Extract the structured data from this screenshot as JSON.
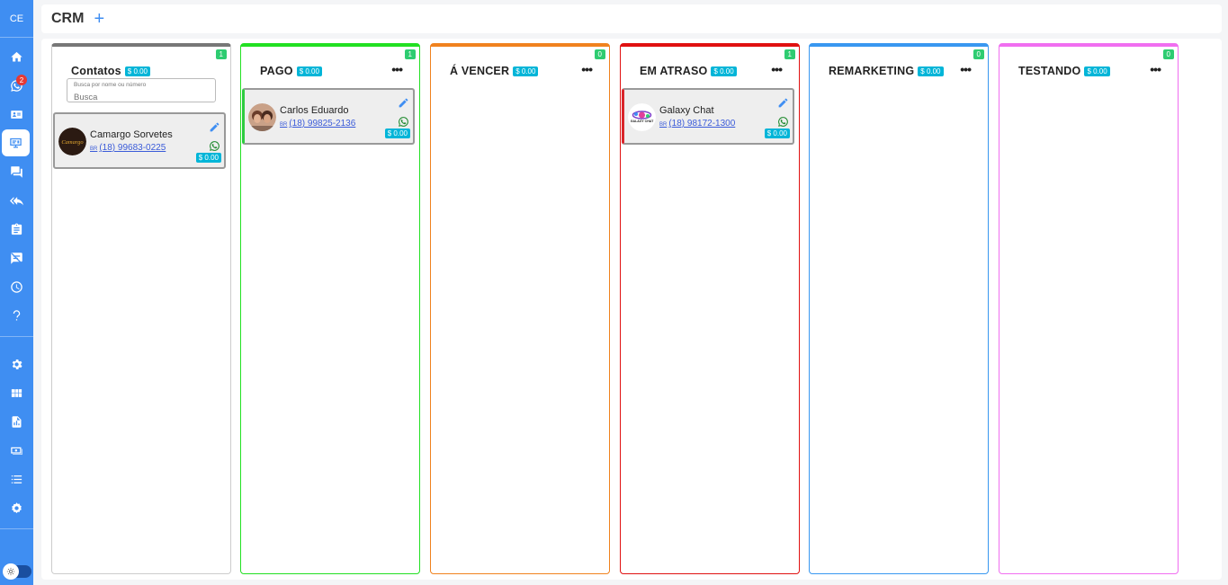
{
  "sidebar": {
    "initials": "CE",
    "notif_count": "2",
    "items": [
      {
        "icon": "home-icon"
      },
      {
        "icon": "whatsapp-icon"
      },
      {
        "icon": "contact-card-icon"
      },
      {
        "icon": "crm-board-icon"
      },
      {
        "icon": "chat-bubbles-icon"
      },
      {
        "icon": "reply-all-icon"
      },
      {
        "icon": "clipboard-icon"
      },
      {
        "icon": "speaker-notes-off-icon"
      },
      {
        "icon": "clock-icon"
      },
      {
        "icon": "help-icon"
      },
      {
        "icon": "settings-gear-icon"
      },
      {
        "icon": "dashboard-icon"
      },
      {
        "icon": "report-file-icon"
      },
      {
        "icon": "money-icon"
      },
      {
        "icon": "list-icon"
      },
      {
        "icon": "settings-cog-icon"
      }
    ]
  },
  "header": {
    "title": "CRM",
    "add_label": "+"
  },
  "search": {
    "label": "Busca por nome ou número",
    "placeholder": "Busca"
  },
  "colors": {
    "primary": "#3f8ef2",
    "sum_badge": "#00b5d8",
    "count_badge": "#2ecc71"
  },
  "columns": [
    {
      "title": "Contatos",
      "sum": "$ 0.00",
      "count": "1",
      "color": "#777777"
    },
    {
      "title": "PAGO",
      "sum": "$ 0.00",
      "count": "1",
      "color": "#22e022"
    },
    {
      "title": "Á VENCER",
      "sum": "$ 0.00",
      "count": "0",
      "color": "#f0821e"
    },
    {
      "title": "EM ATRASO",
      "sum": "$ 0.00",
      "count": "1",
      "color": "#e01010"
    },
    {
      "title": "REMARKETING",
      "sum": "$ 0.00",
      "count": "0",
      "color": "#3897f0"
    },
    {
      "title": "TESTANDO",
      "sum": "$ 0.00",
      "count": "0",
      "color": "#f06ef0"
    }
  ],
  "cards": [
    {
      "name": "Camargo Sorvetes",
      "country": "BR",
      "phone": "(18) 99683-0225",
      "sum": "$ 0.00",
      "avatar_text": "Camargo"
    },
    {
      "name": "Carlos Eduardo",
      "country": "BR",
      "phone": "(18) 99825-2136",
      "sum": "$ 0.00"
    },
    {
      "name": "Galaxy Chat",
      "country": "BR",
      "phone": "(18) 98172-1300",
      "sum": "$ 0.00",
      "avatar_text": "GALAXY CHAT"
    }
  ]
}
